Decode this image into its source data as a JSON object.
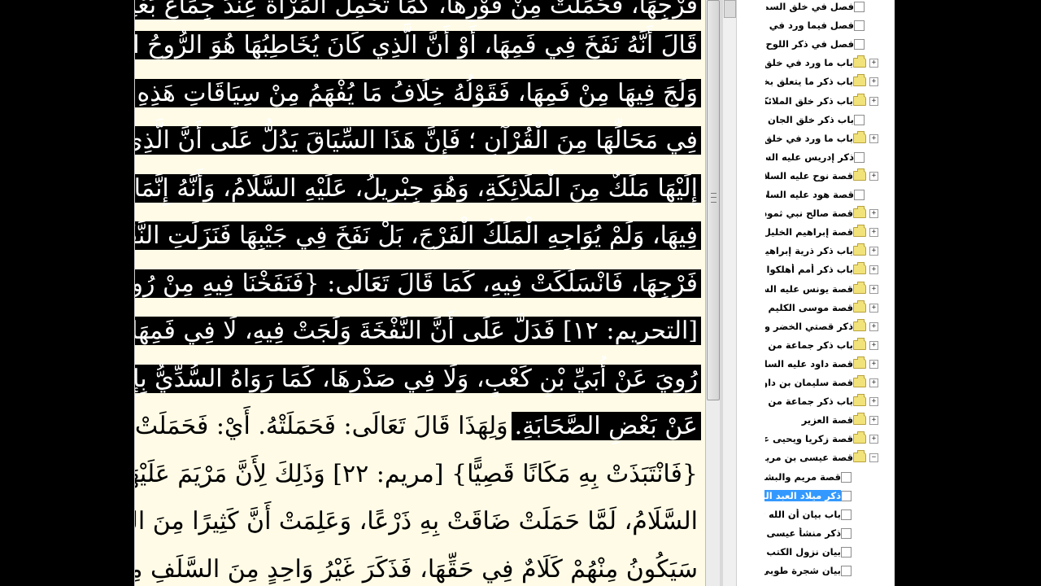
{
  "reader": {
    "lines": [
      {
        "text": "فَرْجِهَا، فَحَمَلَتْ مِنْ فَوْرِهَا، كَمَا تَحْمِلُ الْمَرْأَةُ عِنْدَ جِمَاعِ بَعْلِهَا. وَمَنْ",
        "selected": true
      },
      {
        "text": "قَالَ أَنَّهُ نَفَخَ فِي فَمِهَا، أَوْ أَنَّ الَّذِي كَانَ يُخَاطِبُهَا هُوَ الرُّوحُ الَّذِي",
        "selected": true
      },
      {
        "text": "وَلَجَ فِيهَا مِنْ فَمِهَا، فَقَوْلُهُ خِلَافُ مَا يُفْهَمُ مِنْ سِيَاقَاتِ هَذِهِ الْقِصَّةِ",
        "selected": true
      },
      {
        "text": "فِي مَحَالِّهَا مِنَ الْقُرْآنِ ؛ فَإِنَّ هَذَا السِّيَاقَ يَدُلُّ عَلَى أَنَّ الَّذِي أُرْسِلَ",
        "selected": true
      },
      {
        "text": "إِلَيْهَا مَلَكٌ مِنَ الْمَلَائِكَةِ، وَهُوَ جِبْرِيلُ، عَلَيْهِ السَّلَامُ، وَأَنَّهُ إِنَّمَا نَفَخَ",
        "selected": true
      },
      {
        "text": "فِيهَا، وَلَمْ يُوَاجِهِ الْمَلَكُ الْفَرْجَ، بَلْ نَفَخَ فِي جَيْبِهَا فَنَزَلَتِ النَّفْخَةُ إِلَى",
        "selected": true
      },
      {
        "text": "فَرْجِهَا، فَانْسَلَكَتْ فِيهِ، كَمَا قَالَ تَعَالَى: {فَنَفَخْنَا فِيهِ مِنْ رُوحِنَا}",
        "selected": true
      },
      {
        "text": "[التحريم: ١٢] فَدَلَّ عَلَى أَنَّ النَّفْخَةَ وَلَجَتْ فِيهِ، لَا فِي فَمِهَا، كَمَا",
        "selected": true
      },
      {
        "text": "رُوِيَ عَنْ أُبَيِّ بْنِ كَعْبٍ، وَلَا فِي صَدْرِهَا، كَمَا رَوَاهُ السُّدِّيُّ بِإِسْنَادِهِ",
        "selected": true
      },
      {
        "text": "عَنْ بَعْضِ الصَّحَابَةِ.",
        "selected": true,
        "tail": "وَلِهَذَا قَالَ تَعَالَى: فَحَمَلَتْهُ. أَيْ: فَحَمَلَتْ وَلَدَهَا"
      },
      {
        "text": "{فَانْتَبَذَتْ بِهِ مَكَانًا قَصِيًّا} [مريم: ٢٢] وَذَلِكَ لِأَنَّ مَرْيَمَ عَلَيْهَا",
        "selected": false
      },
      {
        "text": "السَّلَامُ، لَمَّا حَمَلَتْ ضَاقَتْ بِهِ ذَرْعًا، وَعَلِمَتْ أَنَّ كَثِيرًا مِنَ النَّاسِ",
        "selected": false
      },
      {
        "text": "سَيَكُونُ مِنْهُمْ كَلَامٌ فِي حَقِّهَا، فَذَكَرَ غَيْرُ وَاحِدٍ مِنَ السَّلَفِ مِنْهُمْ",
        "selected": false
      }
    ]
  },
  "toc": {
    "items": [
      {
        "label": "فصل في خلق السماوات",
        "icon": "checkbox",
        "expander": ""
      },
      {
        "label": "فصل فيما ورد في صفة",
        "icon": "checkbox",
        "expander": ""
      },
      {
        "label": "فصل في ذكر اللوح المحفوظ",
        "icon": "checkbox",
        "expander": ""
      },
      {
        "label": "باب ما ورد في خلق السماوات",
        "icon": "folder",
        "expander": "+"
      },
      {
        "label": "باب ذكر ما يتعلق بخلق",
        "icon": "folder",
        "expander": "+"
      },
      {
        "label": "باب ذكر خلق الملائكة",
        "icon": "folder",
        "expander": "+"
      },
      {
        "label": "باب ذكر خلق الجان",
        "icon": "checkbox",
        "expander": ""
      },
      {
        "label": "باب ما ورد في خلق آدم",
        "icon": "folder",
        "expander": "+"
      },
      {
        "label": "ذكر إدريس عليه السلام",
        "icon": "checkbox",
        "expander": ""
      },
      {
        "label": "قصة نوح عليه السلام",
        "icon": "folder",
        "expander": "+"
      },
      {
        "label": "قصة هود عليه السلام",
        "icon": "checkbox",
        "expander": ""
      },
      {
        "label": "قصة صالح نبي ثمود",
        "icon": "folder",
        "expander": "+"
      },
      {
        "label": "قصة إبراهيم الخليل عليه",
        "icon": "folder",
        "expander": "+"
      },
      {
        "label": "باب ذكر ذرية إبراهيم",
        "icon": "folder",
        "expander": "+"
      },
      {
        "label": "باب ذكر أمم أهلكوا بعامة",
        "icon": "folder",
        "expander": "+"
      },
      {
        "label": "قصة يونس عليه السلام",
        "icon": "folder",
        "expander": "+"
      },
      {
        "label": "قصة موسى الكليم عليه",
        "icon": "folder",
        "expander": "+"
      },
      {
        "label": "ذكر قصتي الخضر وإلياس",
        "icon": "folder",
        "expander": "+"
      },
      {
        "label": "باب ذكر جماعة من أنبياء",
        "icon": "folder",
        "expander": "+"
      },
      {
        "label": "قصة داود عليه السلام",
        "icon": "folder",
        "expander": "+"
      },
      {
        "label": "قصة سليمان بن داود",
        "icon": "folder",
        "expander": "+"
      },
      {
        "label": "باب ذكر جماعة من أنبياء",
        "icon": "folder",
        "expander": "+"
      },
      {
        "label": "قصة العزير",
        "icon": "folder",
        "expander": "+"
      },
      {
        "label": "قصة زكريا ويحيى عليهما",
        "icon": "folder",
        "expander": "+"
      },
      {
        "label": "قصة عيسى بن مريم",
        "icon": "folder",
        "expander": "−"
      },
      {
        "label": "قصة مريم والبشارة",
        "icon": "checkbox",
        "expander": "",
        "child": true
      },
      {
        "label": "ذكر ميلاد العبد الرسول",
        "icon": "checkbox",
        "expander": "",
        "child": true,
        "selected": true
      },
      {
        "label": "باب بيان أن الله تعالى",
        "icon": "checkbox",
        "expander": "",
        "child": true
      },
      {
        "label": "ذكر منشأ عيسى",
        "icon": "checkbox",
        "expander": "",
        "child": true
      },
      {
        "label": "بيان نزول الكتب الأربعة",
        "icon": "checkbox",
        "expander": "",
        "child": true
      },
      {
        "label": "بيان شجرة طوبى",
        "icon": "checkbox",
        "expander": "",
        "child": true
      }
    ]
  }
}
